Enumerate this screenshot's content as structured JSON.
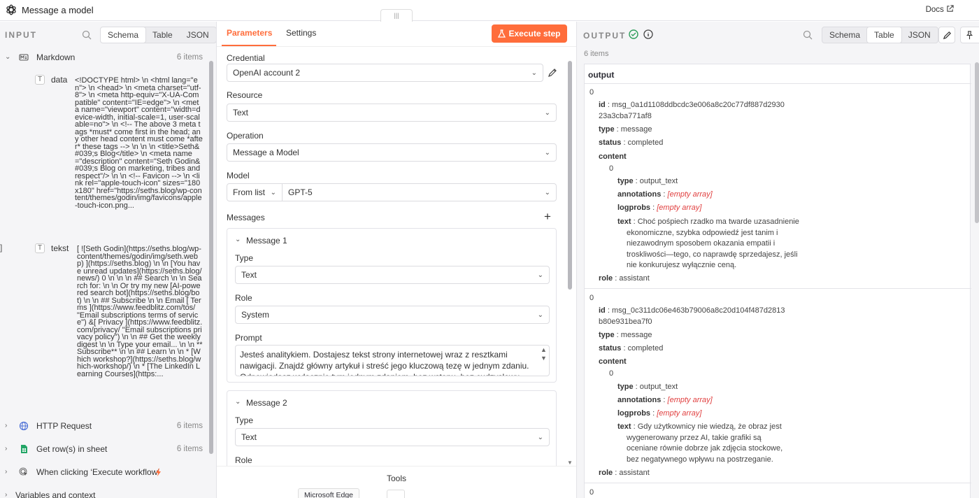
{
  "window": {
    "title": "Message a model",
    "docs": "Docs"
  },
  "input": {
    "heading": "INPUT",
    "views": [
      "Schema",
      "Table",
      "JSON"
    ],
    "active_view": "Schema",
    "nodes": [
      {
        "name": "Markdown",
        "count": "6 items"
      },
      {
        "name": "HTTP Request",
        "count": "6 items"
      },
      {
        "name": "Get row(s) in sheet",
        "count": "6 items"
      },
      {
        "name": "When clicking ‘Execute workflow’",
        "count": ""
      },
      {
        "name": "Variables and context",
        "count": ""
      }
    ],
    "fields": [
      {
        "name": "data",
        "value": "<!DOCTYPE html> \\n <html lang=\"en\"> \\n <head> \\n <meta charset=\"utf-8\"> \\n <meta http-equiv=\"X-UA-Compatible\" content=\"IE=edge\"> \\n <meta name=\"viewport\" content=\"width=device-width, initial-scale=1, user-scalable=no\"> \\n <!-- The above 3 meta tags *must* come first in the head; any other head content must come *after* these tags --> \\n \\n \\n <title>Seth&#039;s Blog</title> \\n <meta name=\"description\" content=\"Seth Godin&#039;s Blog on marketing, tribes and respect\"/> \\n \\n <!-- Favicon --> \\n <link rel=\"apple-touch-icon\" sizes=\"180x180\" href=\"https://seths.blog/wp-content/themes/godin/img/favicons/apple-touch-icon.png..."
      },
      {
        "name": "tekst",
        "value": "[ ![Seth Godin](https://seths.blog/wp-content/themes/godin/img/seth.webp) ](https://seths.blog) \\n \\n [You have unread updates](https://seths.blog/news/) 0 \\n \\n \\n ## Search \\n \\n Search for: \\n \\n Or try my new [AI-powered search bot](https://seths.blog/bot) \\n \\n ## Subscribe \\n \\n Email [ Terms ](https://www.feedblitz.com/tos/ \"Email subscriptions terms of service\") &[ Privacy ](https://www.feedblitz.com/privacy/ \"Email subscriptions privacy policy\") \\n \\n ## Get the weekly digest \\n \\n Type your email... \\n \\n **Subscribe** \\n \\n ## Learn \\n \\n * [Which workshop?](https://seths.blog/which-workshop/) \\n * [The LinkedIn Learning Courses](https:..."
      }
    ]
  },
  "params": {
    "tabs": [
      "Parameters",
      "Settings"
    ],
    "execute_label": "Execute step",
    "credential_label": "Credential",
    "credential_value": "OpenAI account 2",
    "resource_label": "Resource",
    "resource_value": "Text",
    "operation_label": "Operation",
    "operation_value": "Message a Model",
    "model_label": "Model",
    "model_mode": "From list",
    "model_value": "GPT-5",
    "messages_label": "Messages",
    "message1": {
      "title": "Message 1",
      "type_label": "Type",
      "type_value": "Text",
      "role_label": "Role",
      "role_value": "System",
      "prompt_label": "Prompt",
      "prompt_value": "Jesteś analitykiem. Dostajesz tekst strony internetowej wraz z resztkami nawigacji. Znajdź główny artykuł i streść jego kluczową tezę w jednym zdaniu. Odpowiadasz wyłącznie tym jednym zdaniem, bez wstępu, bez cudzysłowu"
    },
    "message2": {
      "title": "Message 2",
      "type_label": "Type",
      "type_value": "Text",
      "role_label": "Role"
    },
    "tools_label": "Tools",
    "edge_label": "Microsoft Edge"
  },
  "output": {
    "heading": "OUTPUT",
    "views": [
      "Schema",
      "Table",
      "JSON"
    ],
    "active_view": "Table",
    "count": "6 items",
    "column": "output",
    "items": [
      {
        "index": "0",
        "id": "msg_0a1d1108ddbcdc3e006a8c20c77df887d2930 23a3cba771af8",
        "type": "message",
        "status": "completed",
        "content_index": "0",
        "ctype": "output_text",
        "annotations": "[empty array]",
        "logprobs": "[empty array]",
        "text": "Choć pośpiech rzadko ma twarde uzasadnienie ekonomiczne, szybka odpowiedź jest tanim i niezawodnym sposobem okazania empatii i troskliwości—tego, co naprawdę sprzedajesz, jeśli nie konkurujesz wyłącznie ceną.",
        "role": "assistant"
      },
      {
        "index": "0",
        "id": "msg_0c311dc06e463b79006a8c20d104f487d2813 b80e931bea7f0",
        "type": "message",
        "status": "completed",
        "content_index": "0",
        "ctype": "output_text",
        "annotations": "[empty array]",
        "logprobs": "[empty array]",
        "text": "Gdy użytkownicy nie wiedzą, że obraz jest wygenerowany przez AI, takie grafiki są oceniane równie dobrze jak zdjęcia stockowe, bez negatywnego wpływu na postrzeganie.",
        "role": "assistant"
      },
      {
        "index": "0"
      }
    ],
    "keys": {
      "id": "id",
      "type": "type",
      "status": "status",
      "content": "content",
      "annotations": "annotations",
      "logprobs": "logprobs",
      "text": "text",
      "role": "role"
    }
  },
  "colors": {
    "accent": "#ff6d3b",
    "empty": "#e03e3e",
    "success": "#2e9e5b"
  }
}
